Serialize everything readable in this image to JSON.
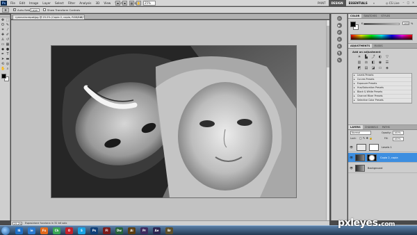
{
  "menubar": {
    "logo": "Ps",
    "items": [
      "File",
      "Edit",
      "Image",
      "Layer",
      "Select",
      "Filter",
      "Analysis",
      "3D",
      "View",
      "Window",
      "Help"
    ],
    "zoom": "25%",
    "workspaces": [
      "PAINT",
      "DESIGN",
      "ESSENTIALS",
      "»"
    ],
    "cs_live": "CS Live"
  },
  "options": {
    "auto_select_label": "Auto-Select:",
    "auto_select_value": "Layer",
    "show_transform_label": "Show Transform Controls"
  },
  "document": {
    "tab_title": "ryannaincrepakjpg @ 25.2% (Copia 2, copia, RGB/8#) *",
    "close_glyph": "×"
  },
  "status": {
    "zoom": "25,2%",
    "text": "Esposizione funziona in 32 bit solo"
  },
  "color_panel": {
    "tabs": [
      "COLOR",
      "SWATCHES",
      "STYLES"
    ],
    "channel_label": "K",
    "value": "100",
    "unit": "%"
  },
  "adjustments": {
    "tabs": [
      "ADJUSTMENTS",
      "MASKS"
    ],
    "title": "Add an adjustment",
    "presets": [
      "Levels Presets",
      "Curves Presets",
      "Exposure Presets",
      "Hue/Saturation Presets",
      "Black & White Presets",
      "Channel Mixer Presets",
      "Selective Color Presets"
    ]
  },
  "layers_panel": {
    "tabs": [
      "LAYERS",
      "CHANNELS",
      "PATHS"
    ],
    "blend_mode": "Normal",
    "opacity_label": "Opacity:",
    "opacity_value": "100%",
    "lock_label": "Lock:",
    "fill_label": "Fill:",
    "fill_value": "100%",
    "layers": [
      {
        "name": "Levels 1",
        "selected": false
      },
      {
        "name": "Copia 2, copia",
        "selected": true
      },
      {
        "name": "Background",
        "selected": false
      }
    ]
  },
  "taskbar": {
    "apps": [
      {
        "label": "IE",
        "color": "#1e6fc7"
      },
      {
        "label": "ie",
        "color": "#2b7ad0"
      },
      {
        "label": "Fx",
        "color": "#e06a1d"
      },
      {
        "label": "Ch",
        "color": "#3aa655"
      },
      {
        "label": "O",
        "color": "#c4202a"
      },
      {
        "label": "S",
        "color": "#1aa3e4"
      },
      {
        "label": "Ps",
        "color": "#0f3e77"
      },
      {
        "label": "Fl",
        "color": "#7a1a1a"
      },
      {
        "label": "Dw",
        "color": "#27633a"
      },
      {
        "label": "Ai",
        "color": "#5a3d12"
      },
      {
        "label": "Pr",
        "color": "#3d2a5e"
      },
      {
        "label": "Ae",
        "color": "#2b2550"
      },
      {
        "label": "Br",
        "color": "#5d4f2a"
      }
    ]
  },
  "watermark": {
    "brand": "pxleyes",
    "dot": ".",
    "tld": "com"
  }
}
